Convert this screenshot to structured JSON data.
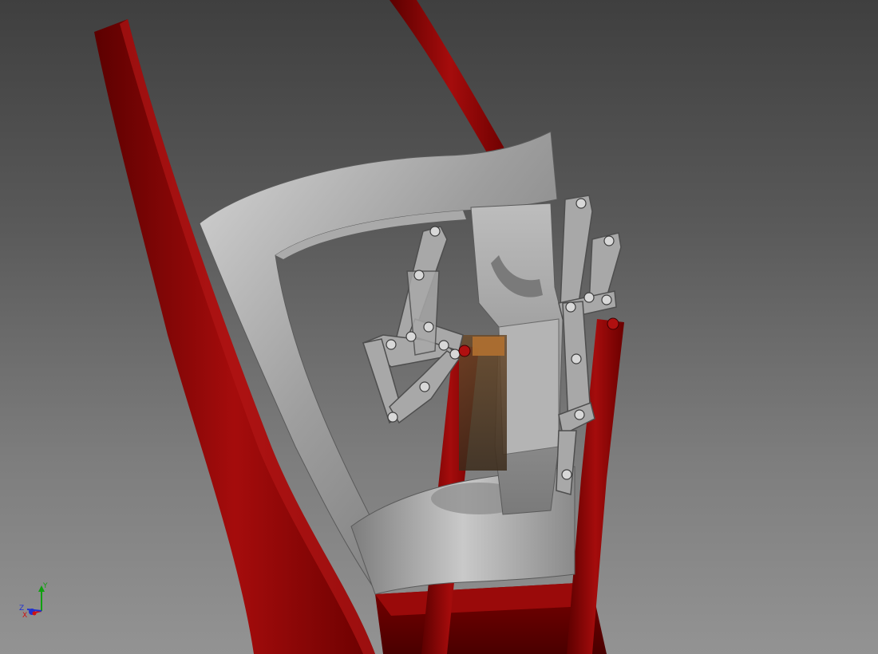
{
  "viewport": {
    "background_top": "#3f3f3f",
    "background_bottom": "#939393"
  },
  "model": {
    "frame_color": "#8b0000",
    "frame_highlight": "#b01010",
    "metal_color": "#9a9a9a",
    "metal_light": "#c8c8c8",
    "metal_dark": "#5e5e5e",
    "accent_color": "#8a5a2a"
  },
  "triad": {
    "x_label": "X",
    "y_label": "Y",
    "z_label": "Z",
    "x_color": "#d01010",
    "y_color": "#10a010",
    "z_color": "#2030d0"
  }
}
